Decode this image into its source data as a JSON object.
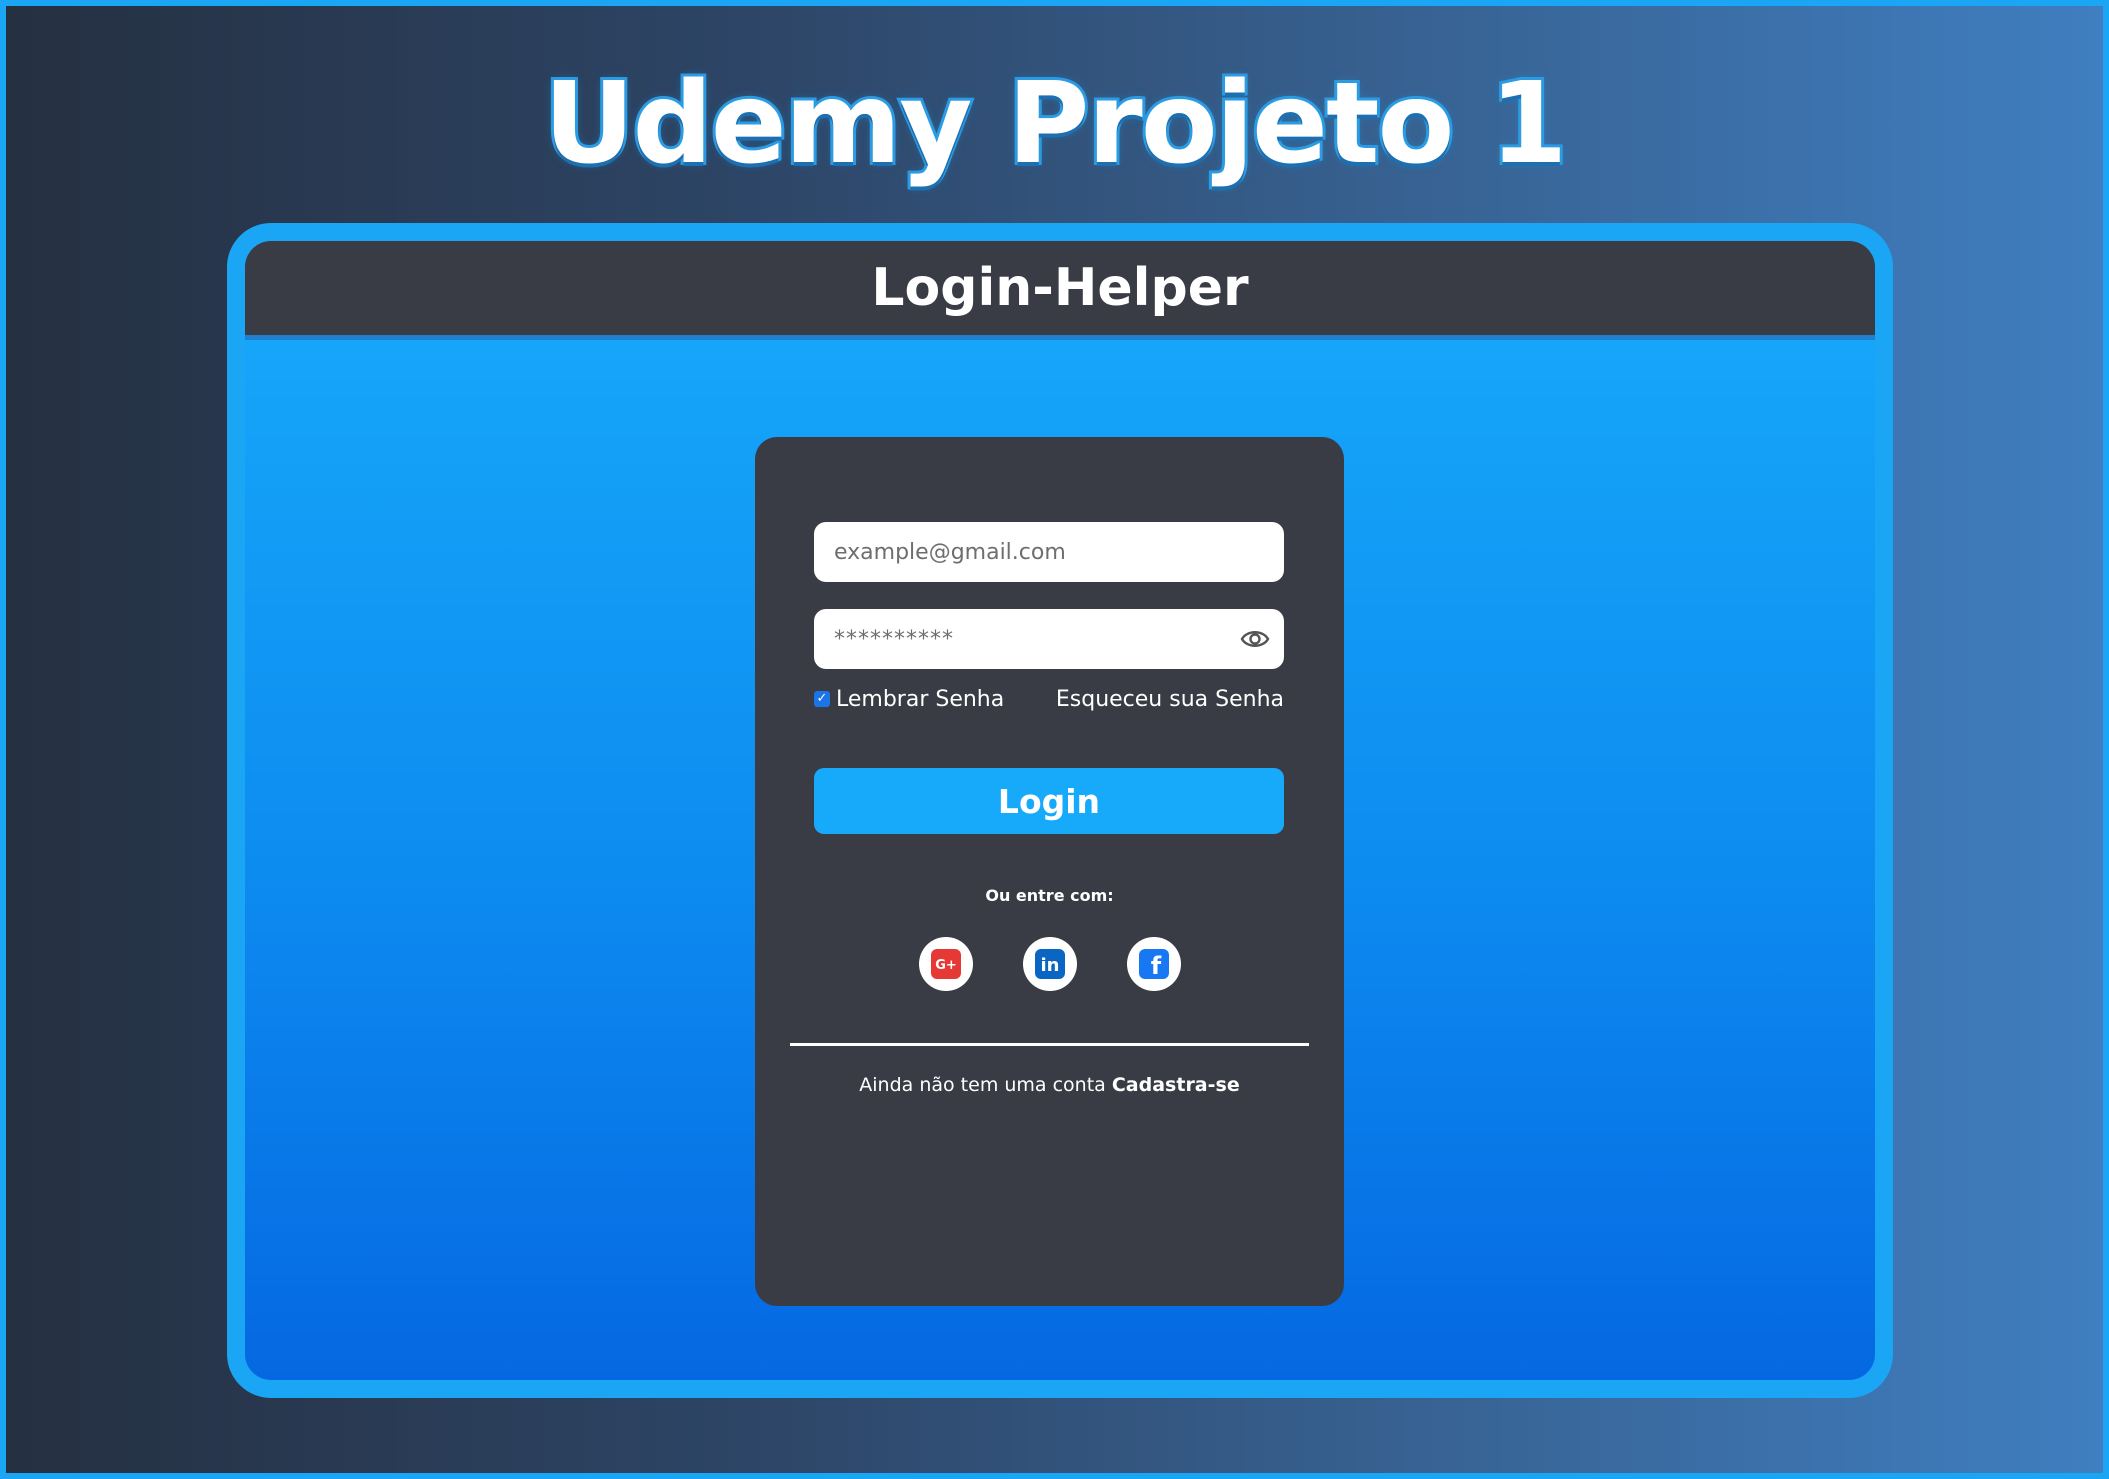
{
  "site_title": "Udemy Projeto 1",
  "app_header": {
    "title": "Login-Helper"
  },
  "login_form": {
    "email_placeholder": "example@gmail.com",
    "password_placeholder": "**********",
    "password_visibility_icon": "eye-icon",
    "remember_label": "Lembrar Senha",
    "remember_checked": true,
    "forgot_label": "Esqueceu sua Senha",
    "login_button_label": "Login"
  },
  "social": {
    "title": "Ou entre com:",
    "providers": [
      {
        "icon": "google-plus-icon",
        "label": "G+"
      },
      {
        "icon": "linkedin-icon",
        "label": "in"
      },
      {
        "icon": "facebook-icon",
        "label": "f"
      }
    ]
  },
  "signup": {
    "text": "Ainda não tem uma conta",
    "link": "Cadastra-se"
  },
  "colors": {
    "accent": "#17aafb",
    "card": "#393c45",
    "border": "#1aa6f5",
    "google": "#e53935",
    "linkedin": "#0a66c2",
    "facebook": "#1877f2"
  }
}
